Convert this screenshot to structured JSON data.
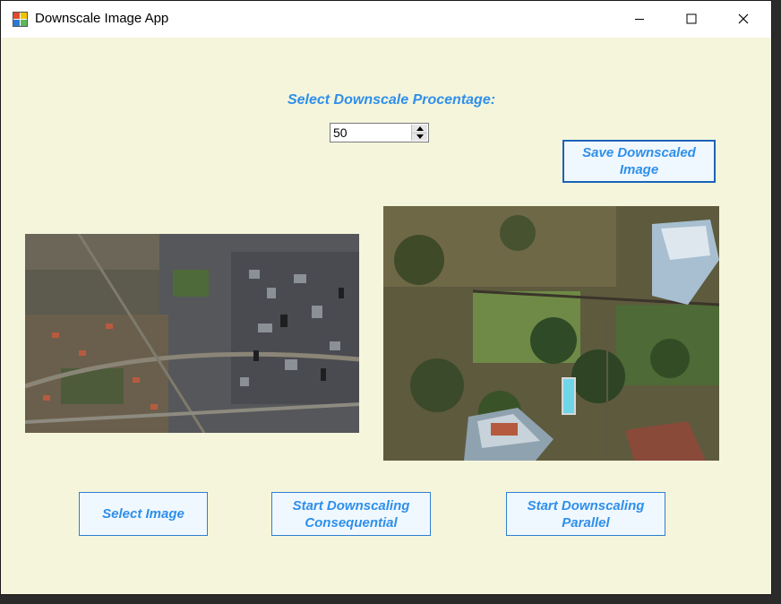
{
  "window": {
    "title": "Downscale Image App",
    "icon": "app-icon",
    "controls": [
      "minimize-icon",
      "maximize-icon",
      "close-icon"
    ]
  },
  "form": {
    "prompt_label": "Select Downscale Procentage:",
    "percentage_value": "50",
    "buttons": {
      "save": "Save Downscaled\nImage",
      "select": "Select Image",
      "consequential": "Start Downscaling\nConsequential",
      "parallel": "Start Downscaling\nParallel"
    }
  },
  "images": {
    "original": "aerial-city-image",
    "downscaled": "aerial-residential-image"
  },
  "colors": {
    "background": "#f5f5dc",
    "accent_text": "#2e8fea",
    "button_border": "#2f7fd0",
    "button_fill": "#f0f8ff"
  }
}
